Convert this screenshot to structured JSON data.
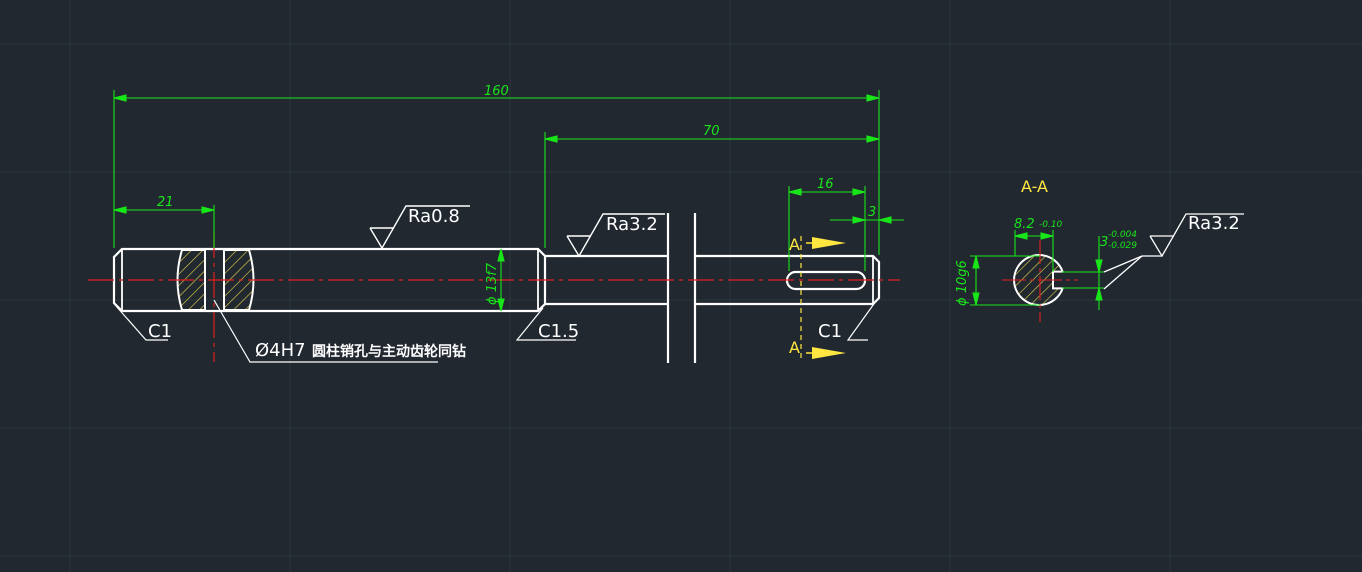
{
  "colors": {
    "background": "#212830",
    "grid": "#2c333c",
    "outline": "#ffffff",
    "dimension": "#19e619",
    "centerline": "#e01e1e",
    "section_marker": "#ffe640",
    "hatch": "#e8d84a"
  },
  "dimensions": {
    "overall_length": "160",
    "tail_length": "70",
    "left_hole_offset": "21",
    "keyway_length": "16",
    "keyway_end_offset": "3",
    "main_diameter": "ϕ 13f7",
    "section_diameter": "ϕ 10g6",
    "keyway_depth": "8.2",
    "keyway_depth_tol": "-0.10",
    "keyway_width": "3",
    "keyway_width_tol_upper": "-0.004",
    "keyway_width_tol_lower": "-0.029"
  },
  "roughness": {
    "main": "Ra0.8",
    "tail": "Ra3.2",
    "section": "Ra3.2"
  },
  "chamfers": {
    "left": "C1",
    "shoulder": "C1.5",
    "right": "C1"
  },
  "hole_note": {
    "size": "Ø4H7",
    "text": "圆柱销孔与主动齿轮同钻"
  },
  "section": {
    "title": "A-A",
    "mark_top": "A",
    "mark_bottom": "A"
  }
}
